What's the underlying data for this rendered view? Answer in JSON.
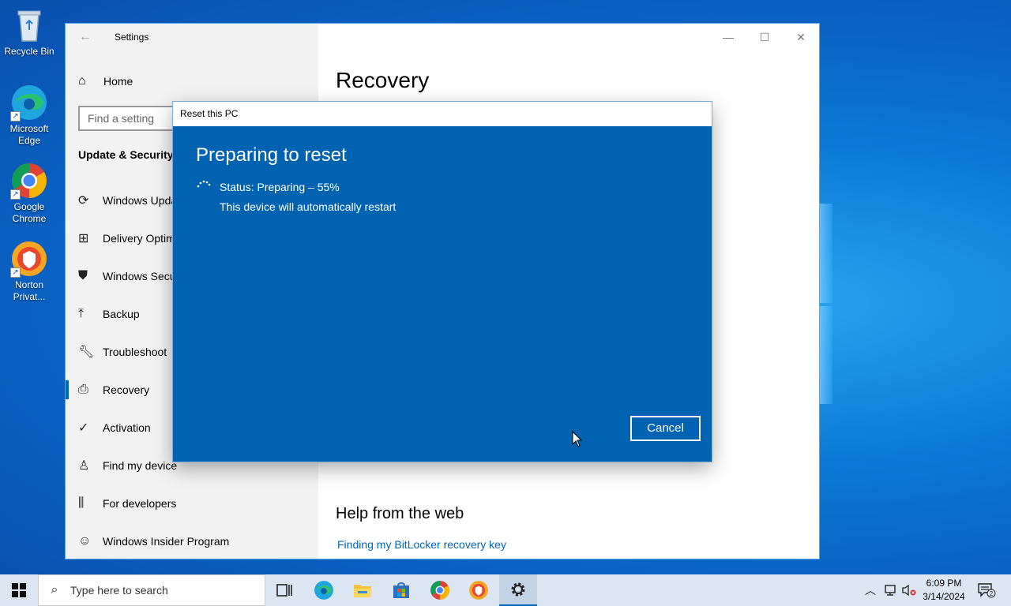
{
  "desktop": {
    "icons": [
      {
        "label_lines": [
          "Recycle Bin"
        ]
      },
      {
        "label_lines": [
          "Microsoft",
          "Edge"
        ]
      },
      {
        "label_lines": [
          "Google",
          "Chrome"
        ]
      },
      {
        "label_lines": [
          "Norton",
          "Privat..."
        ]
      }
    ]
  },
  "settings": {
    "title": "Settings",
    "home": "Home",
    "search_placeholder": "Find a setting",
    "section": "Update & Security",
    "nav": [
      {
        "label": "Windows Update",
        "icon": "sync-icon"
      },
      {
        "label": "Delivery Optimization",
        "icon": "delivery-icon"
      },
      {
        "label": "Windows Security",
        "icon": "shield-icon"
      },
      {
        "label": "Backup",
        "icon": "upload-icon"
      },
      {
        "label": "Troubleshoot",
        "icon": "wrench-icon"
      },
      {
        "label": "Recovery",
        "icon": "recovery-icon"
      },
      {
        "label": "Activation",
        "icon": "check-circle-icon"
      },
      {
        "label": "Find my device",
        "icon": "person-icon"
      },
      {
        "label": "For developers",
        "icon": "developer-icon"
      },
      {
        "label": "Windows Insider Program",
        "icon": "insider-icon"
      }
    ],
    "active_item": "Recovery",
    "page_title": "Recovery",
    "help_title": "Help from the web",
    "help_link": "Finding my BitLocker recovery key"
  },
  "dialog": {
    "title": "Reset this PC",
    "heading": "Preparing to reset",
    "status": "Status: Preparing – 55%",
    "progress_percent": 55,
    "message": "This device will automatically restart",
    "cancel_label": "Cancel"
  },
  "taskbar": {
    "search_placeholder": "Type here to search",
    "apps": [
      "task-view-icon",
      "edge-icon",
      "file-explorer-icon",
      "store-icon",
      "chrome-icon",
      "norton-icon",
      "settings-icon"
    ],
    "time": "6:09 PM",
    "date": "3/14/2024",
    "notification_count": "2"
  },
  "colors": {
    "dialog_bg": "#0063b1",
    "accent": "#0067c0",
    "link": "#0067b8"
  }
}
